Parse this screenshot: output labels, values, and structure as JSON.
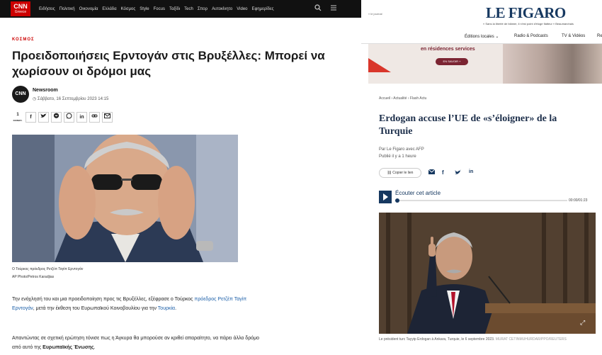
{
  "cnn": {
    "logo": "CNN",
    "logo_sub": "Greece",
    "menu": [
      "Ειδήσεις",
      "Πολιτική",
      "Οικονομία",
      "Ελλάδα",
      "Κόσμος",
      "Style",
      "Focus",
      "Ταξίδι",
      "Tech",
      "Σπορ",
      "Αυτοκίνητο",
      "Video",
      "Εφημερίδες"
    ],
    "search_icon": "search-icon",
    "menu_icon": "hamburger-icon",
    "category": "ΚΟΣΜΟΣ",
    "title": "Προειδοποιήσεις Ερντογάν στις Βρυξέλλες: Μπορεί να χωρίσουν οι δρόμοι μας",
    "author_logo": "CNN",
    "author": "Newsroom",
    "date": "Σάββατο, 16 Σεπτεμβρίου 2023 14:15",
    "share_count": "1",
    "share_count_label": "ΚΟΙΝΟΠ.",
    "share_icons": [
      "facebook-icon",
      "twitter-icon",
      "messenger-icon",
      "whatsapp-icon",
      "linkedin-icon",
      "link-icon",
      "email-icon"
    ],
    "photo_caption": "Ο Τούρκος πρόεδρος Ρετζέπ Ταγίπ Ερντογάν",
    "photo_credit": "AP Photo/Petros Karadjias",
    "p1_a": "Την ενόχλησή του και μια προειδοποίηση προς τις Βρυξέλλες, εξέφρασε ο Τούρκος ",
    "p1_link1": "πρόεδρος Ρετζέπ Ταγίπ Ερντογάν",
    "p1_b": ", μετά την έκθεση του Ευρωπαϊκού Κοινοβουλίου για την ",
    "p1_link2": "Τουρκία",
    "p1_c": ".",
    "p2_a": "Απαντώντας σε σχετική ερώτηση τόνισε πως η Άγκυρα θα μπορούσε αν κριθεί απαραίτητο, να πάρει άλλο δρόμο από αυτό της ",
    "p2_bold": "Ευρωπαϊκής Ένωσης",
    "p2_c": "."
  },
  "figaro": {
    "tagline": "« le journal",
    "logo": "LE FIGARO",
    "quote": "« Sans la liberté de blâmer, il n'est point d'éloge flatteur » Beaumarchais",
    "subnav": [
      "Éditions locales ⌄",
      "Radio & Podcasts",
      "TV & Vidéos",
      "Re"
    ],
    "ad_text": "en résidences services",
    "ad_button": "EN SAVOIR +",
    "breadcrumb": "Accueil  ›  Actualité  ›  Flash Actu",
    "title": "Erdogan accuse l’UE de «s’éloigner» de la Turquie",
    "byline": "Par Le Figaro avec AFP",
    "published": "Publié il y a 1 heure",
    "copy_link": "Copier le lien",
    "share_icons": [
      "email-icon",
      "facebook-icon",
      "twitter-icon",
      "linkedin-icon"
    ],
    "audio_label": "Écouter cet article",
    "audio_time": "00:00/01:23",
    "caption": "Le président turc Tayyip Erdogan à Ankara, Turquie, le 6 septembre 2023. ",
    "caption_credit": "MURAT CETINMUHURDAR/PPO/REUTERS"
  },
  "colors": {
    "cnn_red": "#cc0000",
    "figaro_blue": "#163860",
    "link_blue": "#1a5ea8"
  }
}
